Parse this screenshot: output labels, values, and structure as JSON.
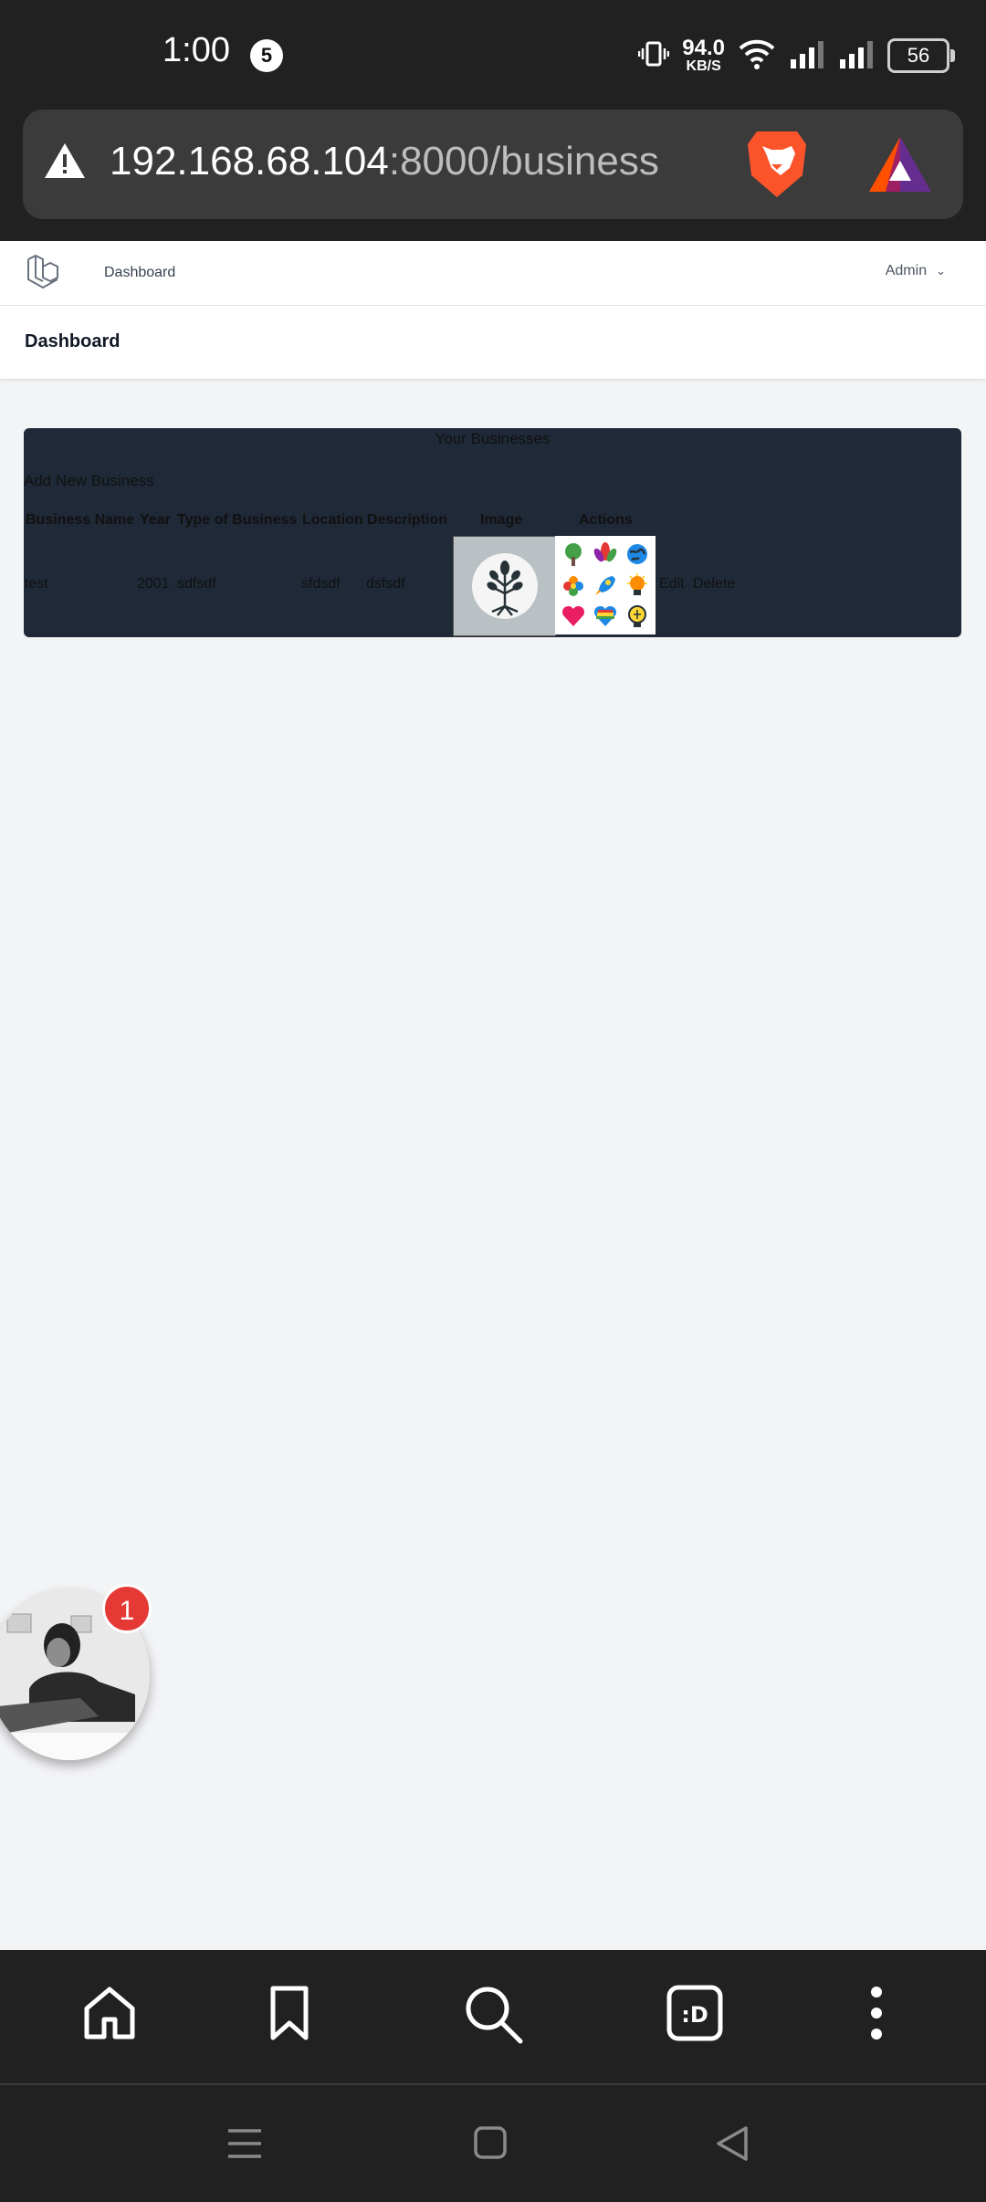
{
  "status_bar": {
    "time": "1:00",
    "notification_count": "5",
    "net_speed_value": "94.0",
    "net_speed_unit": "KB/S",
    "battery": "56"
  },
  "browser": {
    "url_host": "192.168.68.104",
    "url_path": ":8000/business"
  },
  "nav": {
    "dashboard_link": "Dashboard",
    "user_menu": "Admin"
  },
  "page": {
    "title": "Dashboard"
  },
  "businesses": {
    "heading": "Your Businesses",
    "add_link": "Add New Business",
    "columns": [
      "Business Name",
      "Year",
      "Type of Business",
      "Location",
      "Description",
      "Image",
      "Actions"
    ],
    "rows": [
      {
        "name": "test",
        "year": "2001",
        "type": "sdfsdf",
        "location": "sfdsdf",
        "description": "dsfsdf",
        "edit_label": "Edit",
        "delete_label": "Delete"
      }
    ]
  },
  "chat_head": {
    "unread_count": "1"
  },
  "colors": {
    "panel_bg": "#1f2937",
    "page_bg": "#f3f4f6",
    "browser_chrome": "#212121"
  }
}
